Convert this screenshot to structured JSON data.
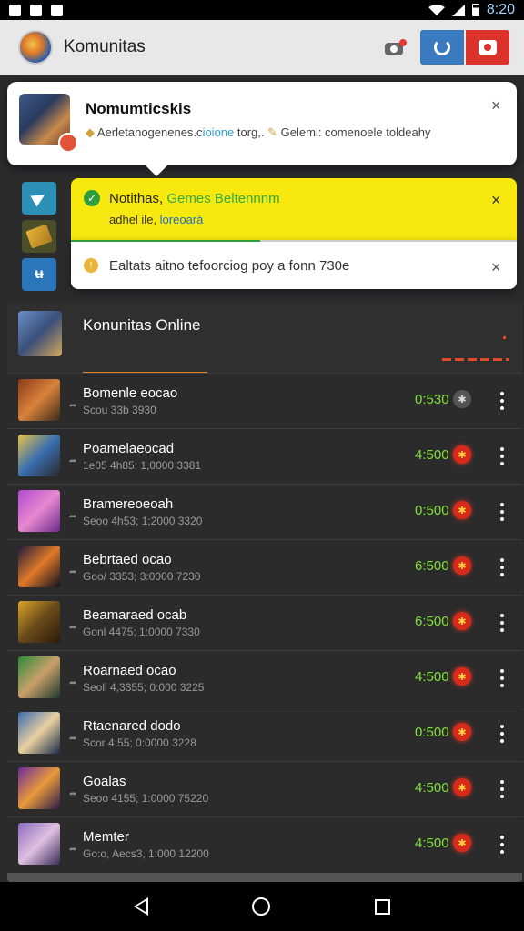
{
  "status_bar": {
    "time": "8:20"
  },
  "app_bar": {
    "title": "Komunitas"
  },
  "notification": {
    "title": "Nomumticskis",
    "sub_before": "Aerletanogenenes.c",
    "sub_highlight": "ioione",
    "sub_mid": " torg,.",
    "sub_after": " Geleml: comenoele toldeahy",
    "close": "×"
  },
  "alert": {
    "title_before": "Notithas, ",
    "title_highlight": "Gemes Beltennnm",
    "sub_before": "adhel ile, ",
    "sub_highlight": "loreoarà",
    "close": "×",
    "check": "✓",
    "info_icon": "!",
    "info_text": "Ealtats aitno tefoorciog poy a fonn 730e",
    "info_close": "×"
  },
  "side_tiles": {
    "t3_glyph": "ʉ"
  },
  "section": {
    "title": "Konunitas Online"
  },
  "rows": [
    {
      "title": "Bomenle eocao",
      "sub": "Scou 33b 3930",
      "score": "0:530",
      "badge": "grey"
    },
    {
      "title": "Poamelaeocad",
      "sub": "1e05 4h85; 1,0000 3381",
      "score": "4:500",
      "badge": "red"
    },
    {
      "title": "Bramereoeoah",
      "sub": "Seoo 4h53; 1;2000 3320",
      "score": "0:500",
      "badge": "red"
    },
    {
      "title": "Bebrtaed ocao",
      "sub": "Goo/ 3353; 3:0000 7230",
      "score": "6:500",
      "badge": "red"
    },
    {
      "title": "Beamaraed ocab",
      "sub": "Gonl 4475; 1:0000 7330",
      "score": "6:500",
      "badge": "red"
    },
    {
      "title": "Roarnaed ocao",
      "sub": "Seoll 4,3355; 0:000 3225",
      "score": "4:500",
      "badge": "red"
    },
    {
      "title": "Rtaenared dodo",
      "sub": "Scor 4:55; 0:0000 3228",
      "score": "0:500",
      "badge": "red"
    },
    {
      "title": "Goalas",
      "sub": "Seoo 4155; 1:0000 75220",
      "score": "4:500",
      "badge": "red"
    },
    {
      "title": "Memter",
      "sub": "Go:o, Aecs3, 1:000 12200",
      "score": "4:500",
      "badge": "red"
    }
  ],
  "row_badge_glyph": "✱",
  "colors": {
    "app_bar": "#e8e8e8",
    "score_green": "#7fe03a",
    "alert_yellow": "#f7e80f",
    "accent_orange": "#e8812b",
    "badge_red": "#d82a1a"
  },
  "icons": [
    "wifi-icon",
    "signal-icon",
    "battery-icon",
    "camera-icon",
    "refresh-icon",
    "chat-icon",
    "check-icon",
    "info-icon",
    "close-icon",
    "more-icon",
    "back-icon",
    "home-icon",
    "recents-icon"
  ]
}
